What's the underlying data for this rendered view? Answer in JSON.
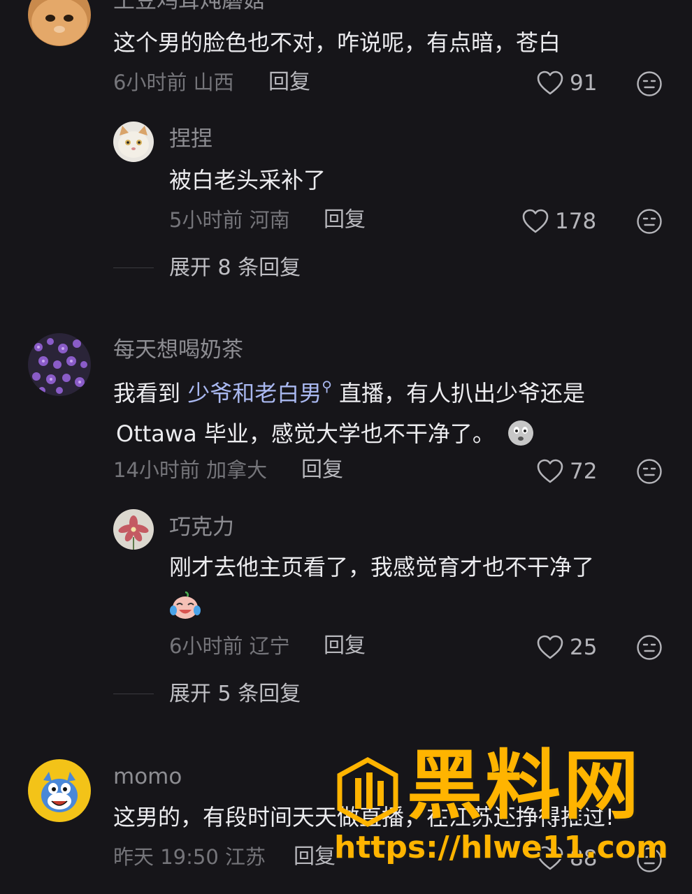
{
  "comments": [
    {
      "username": "土豆鸡茸炖蘑菇",
      "text": "这个男的脸色也不对，咋说呢，有点暗，苍白",
      "time": "6小时前",
      "location": "山西",
      "reply_label": "回复",
      "likes": "91",
      "replies": [
        {
          "username": "捏捏",
          "text": "被白老头采补了",
          "time": "5小时前",
          "location": "河南",
          "reply_label": "回复",
          "likes": "178"
        }
      ],
      "expand_label": "展开 8 条回复"
    },
    {
      "username": "每天想喝奶茶",
      "text_line1_prefix": "我看到 ",
      "mention": "少爷和老白男",
      "text_line1_suffix": " 直播，有人扒出少爷还是",
      "text_line2": "Ottawa 毕业，感觉大学也不干净了。",
      "time": "14小时前",
      "location": "加拿大",
      "reply_label": "回复",
      "likes": "72",
      "replies": [
        {
          "username": "巧克力",
          "text": "刚才去他主页看了，我感觉育才也不干净了",
          "time": "6小时前",
          "location": "辽宁",
          "reply_label": "回复",
          "likes": "25"
        }
      ],
      "expand_label": "展开 5 条回复"
    },
    {
      "username": "momo",
      "text": "这男的，有段时间天天做直播，在江苏还挣得推过!",
      "time": "昨天 19:50",
      "location": "江苏",
      "reply_label": "回复",
      "likes": "88"
    }
  ],
  "watermark": {
    "title": "黑料网",
    "url": "https://hlwe11.com"
  },
  "colors": {
    "background": "#161519",
    "accent_link": "#a9b8f0",
    "watermark": "#ffb400"
  },
  "icons": {
    "like": "heart-outline-icon",
    "dislike": "neutral-face-icon",
    "search_mark": "search-icon"
  }
}
